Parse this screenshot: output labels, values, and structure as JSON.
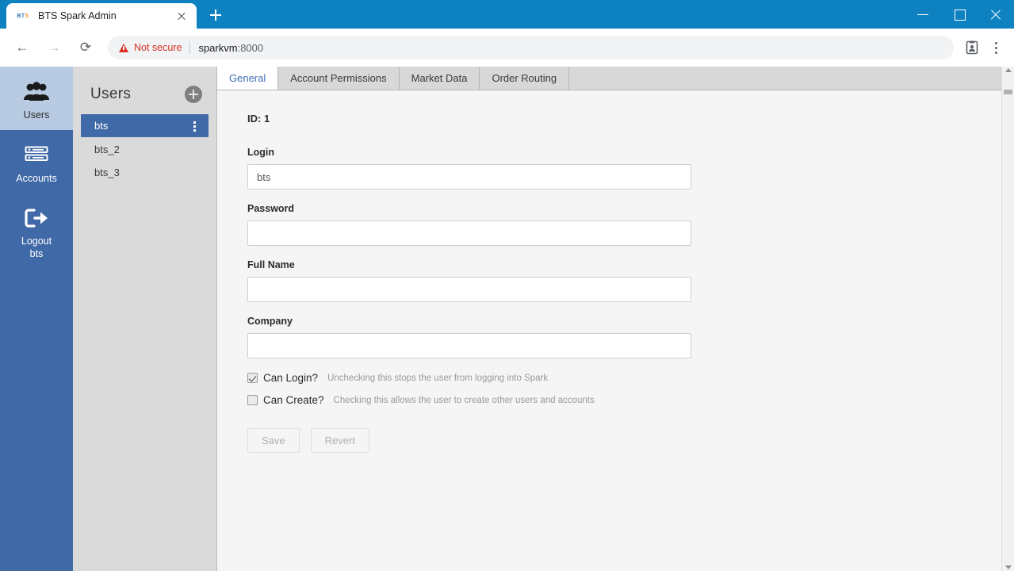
{
  "browser": {
    "tab": {
      "title": "BTS Spark Admin",
      "favicon": "bts-favicon",
      "close_icon": "close-icon"
    },
    "new_tab_icon": "plus-icon",
    "window_controls": {
      "minimize": "minimize-icon",
      "maximize": "maximize-icon",
      "close": "close-icon"
    },
    "nav": {
      "back": "back-arrow-icon",
      "forward": "forward-arrow-icon",
      "reload": "reload-icon"
    },
    "omnibox": {
      "security_label": "Not secure",
      "security_icon": "warning-triangle-icon",
      "host": "sparkvm",
      "port": ":8000"
    },
    "toolbar_icons": {
      "profile": "profile-card-icon",
      "menu": "kebab-menu-icon"
    }
  },
  "rail": {
    "items": [
      {
        "label": "Users",
        "icon": "users-group-icon",
        "active": true
      },
      {
        "label": "Accounts",
        "icon": "server-stack-icon",
        "active": false
      },
      {
        "label": "Logout",
        "sublabel": "bts",
        "icon": "logout-arrow-icon",
        "active": false
      }
    ]
  },
  "users_panel": {
    "title": "Users",
    "add_icon": "plus-circle-icon",
    "items": [
      {
        "name": "bts",
        "selected": true,
        "menu_icon": "kebab-menu-icon"
      },
      {
        "name": "bts_2",
        "selected": false
      },
      {
        "name": "bts_3",
        "selected": false
      }
    ]
  },
  "content": {
    "tabs": [
      {
        "label": "General",
        "active": true
      },
      {
        "label": "Account Permissions",
        "active": false
      },
      {
        "label": "Market Data",
        "active": false
      },
      {
        "label": "Order Routing",
        "active": false
      }
    ],
    "id_line": "ID: 1",
    "fields": [
      {
        "label": "Login",
        "value": "bts",
        "placeholder": ""
      },
      {
        "label": "Password",
        "value": "",
        "placeholder": ""
      },
      {
        "label": "Full Name",
        "value": "",
        "placeholder": ""
      },
      {
        "label": "Company",
        "value": "",
        "placeholder": ""
      }
    ],
    "checkboxes": [
      {
        "label": "Can Login?",
        "checked": true,
        "hint": "Unchecking this stops the user from logging into Spark"
      },
      {
        "label": "Can Create?",
        "checked": false,
        "hint": "Checking this allows the user to create other users and accounts"
      }
    ],
    "buttons": [
      {
        "label": "Save",
        "disabled": true
      },
      {
        "label": "Revert",
        "disabled": true
      }
    ]
  },
  "colors": {
    "titlebar_blue": "#0e81c0",
    "rail_blue": "#4069a8",
    "rail_active": "#b8cbe3",
    "panel_gray": "#dadada",
    "content_bg": "#f5f5f5",
    "accent_link": "#3f6fb5",
    "danger_red": "#d93025"
  }
}
